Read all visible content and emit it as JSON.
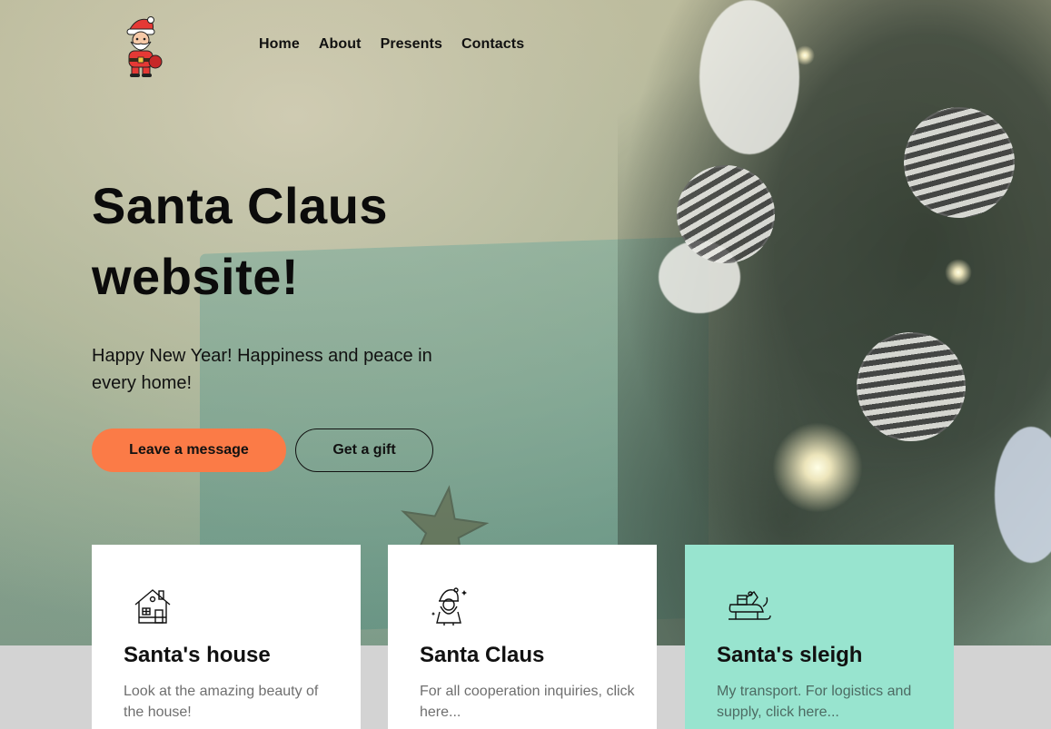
{
  "nav": {
    "items": [
      {
        "label": "Home"
      },
      {
        "label": "About"
      },
      {
        "label": "Presents"
      },
      {
        "label": "Contacts"
      }
    ]
  },
  "hero": {
    "title": "Santa Claus website!",
    "subtitle": "Happy New Year! Happiness and peace in every home!",
    "primary_button": "Leave a message",
    "secondary_button": "Get a gift"
  },
  "cards": [
    {
      "icon": "house-icon",
      "title": "Santa's house",
      "text": "Look at the amazing beauty of the house!"
    },
    {
      "icon": "santa-icon",
      "title": "Santa Claus",
      "text": "For all cooperation inquiries, click here..."
    },
    {
      "icon": "sleigh-icon",
      "title": "Santa's sleigh",
      "text": "My transport. For logistics and supply, click here..."
    }
  ],
  "colors": {
    "primary_button": "#fb7b47",
    "highlight_card": "#98e4cf",
    "footer_band": "#d3d3d3"
  }
}
